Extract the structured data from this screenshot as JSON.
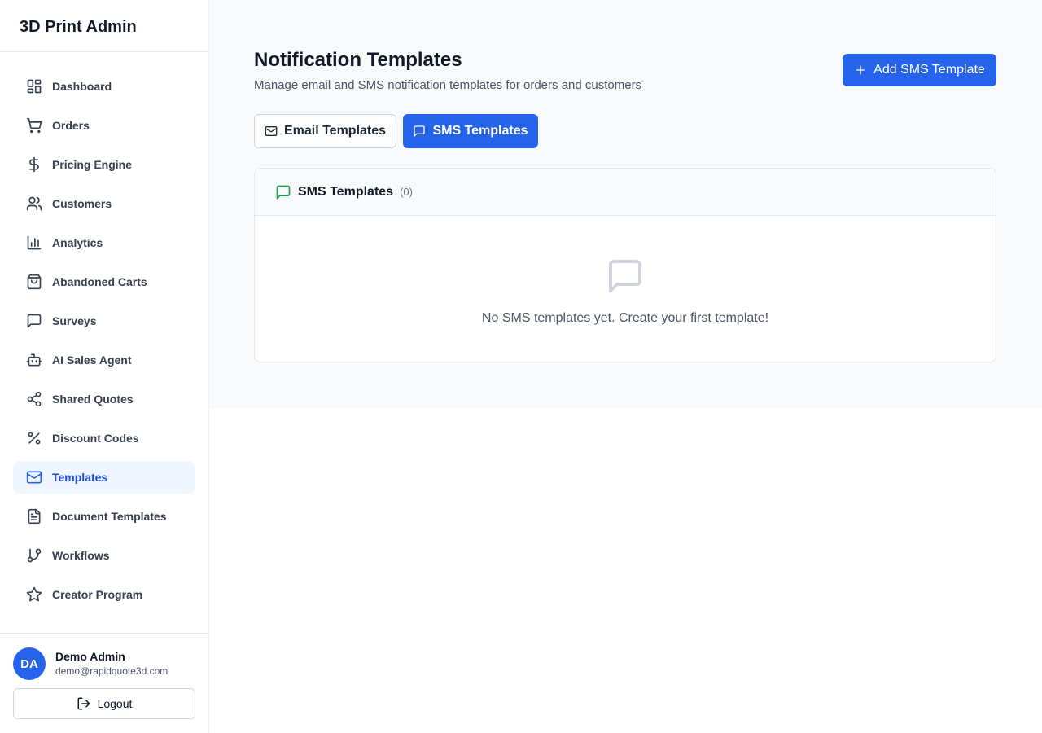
{
  "brand": "3D Print Admin",
  "nav": [
    {
      "label": "Dashboard",
      "icon": "dashboard-icon"
    },
    {
      "label": "Orders",
      "icon": "cart-icon"
    },
    {
      "label": "Pricing Engine",
      "icon": "dollar-icon"
    },
    {
      "label": "Customers",
      "icon": "users-icon"
    },
    {
      "label": "Analytics",
      "icon": "bar-chart-icon"
    },
    {
      "label": "Abandoned Carts",
      "icon": "shopping-bag-icon"
    },
    {
      "label": "Surveys",
      "icon": "message-square-icon"
    },
    {
      "label": "AI Sales Agent",
      "icon": "bot-icon"
    },
    {
      "label": "Shared Quotes",
      "icon": "share-icon"
    },
    {
      "label": "Discount Codes",
      "icon": "percent-icon"
    },
    {
      "label": "Templates",
      "icon": "mail-icon",
      "active": true
    },
    {
      "label": "Document Templates",
      "icon": "file-text-icon"
    },
    {
      "label": "Workflows",
      "icon": "git-branch-icon"
    },
    {
      "label": "Creator Program",
      "icon": "star-icon"
    }
  ],
  "user": {
    "initials": "DA",
    "name": "Demo Admin",
    "email": "demo@rapidquote3d.com"
  },
  "logout_label": "Logout",
  "header": {
    "title": "Notification Templates",
    "subtitle": "Manage email and SMS notification templates for orders and customers",
    "add_button_label": "Add SMS Template"
  },
  "tabs": {
    "email_label": "Email Templates",
    "sms_label": "SMS Templates",
    "active": "sms"
  },
  "card": {
    "title": "SMS Templates",
    "count": "(0)",
    "empty_text": "No SMS templates yet. Create your first template!"
  },
  "colors": {
    "accent": "#2563eb",
    "active_nav_bg": "#eff6ff",
    "sms_icon": "#16a34a",
    "page_bg": "#f8f9fb"
  }
}
